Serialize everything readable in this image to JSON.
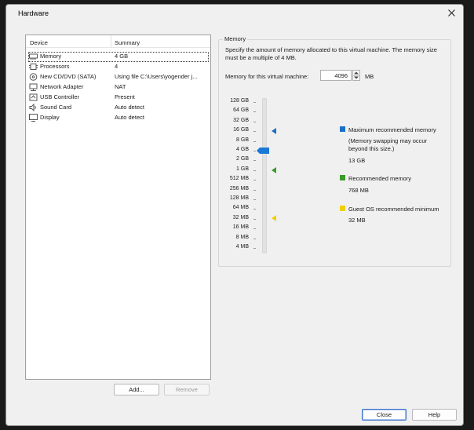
{
  "window": {
    "title": "Hardware"
  },
  "device_list": {
    "columns": [
      "Device",
      "Summary"
    ],
    "items": [
      {
        "name": "Memory",
        "summary": "4 GB",
        "icon": "memory-icon",
        "selected": true
      },
      {
        "name": "Processors",
        "summary": "4",
        "icon": "processor-icon"
      },
      {
        "name": "New CD/DVD (SATA)",
        "summary": "Using file C:\\Users\\yogender j...",
        "icon": "cd-dvd-icon"
      },
      {
        "name": "Network Adapter",
        "summary": "NAT",
        "icon": "network-adapter-icon"
      },
      {
        "name": "USB Controller",
        "summary": "Present",
        "icon": "usb-controller-icon"
      },
      {
        "name": "Sound Card",
        "summary": "Auto detect",
        "icon": "sound-card-icon"
      },
      {
        "name": "Display",
        "summary": "Auto detect",
        "icon": "display-icon"
      }
    ],
    "add_label": "Add...",
    "remove_label": "Remove"
  },
  "memory": {
    "group_label": "Memory",
    "description": "Specify the amount of memory allocated to this virtual machine. The memory size must be a multiple of 4 MB.",
    "field_label": "Memory for this virtual machine:",
    "field_value": "4096",
    "unit": "MB",
    "scale": [
      "128 GB",
      "64 GB",
      "32 GB",
      "16 GB",
      "8 GB",
      "4 GB",
      "2 GB",
      "1 GB",
      "512 MB",
      "256 MB",
      "128 MB",
      "64 MB",
      "32 MB",
      "16 MB",
      "8 MB",
      "4 MB"
    ],
    "current_value": "4 GB",
    "legend": {
      "max": {
        "title": "Maximum recommended memory",
        "note": "(Memory swapping may occur beyond this size.)",
        "value": "13 GB",
        "color": "#1b6fc8"
      },
      "recommended": {
        "title": "Recommended memory",
        "value": "768 MB",
        "color": "#3a9a2a"
      },
      "guest_min": {
        "title": "Guest OS recommended minimum",
        "value": "32 MB",
        "color": "#f0d000"
      }
    },
    "markers": {
      "max_at": "16 GB",
      "recommended_at": "1 GB",
      "guest_min_at": "32 MB"
    }
  },
  "footer": {
    "close_label": "Close",
    "help_label": "Help"
  }
}
